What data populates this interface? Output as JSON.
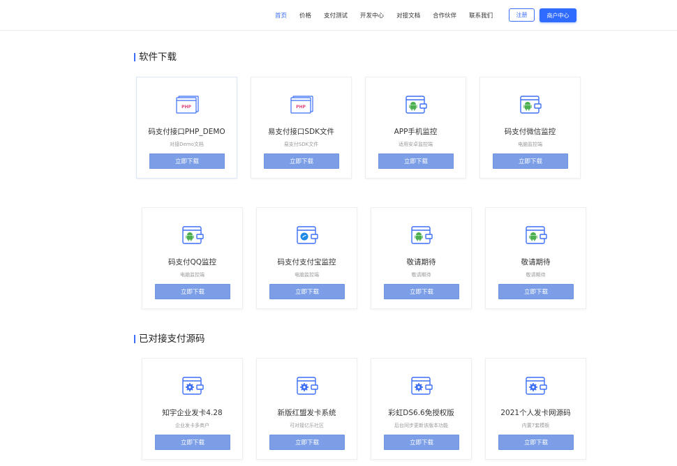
{
  "nav": {
    "items": [
      {
        "label": "首页",
        "active": true
      },
      {
        "label": "价格",
        "active": false
      },
      {
        "label": "支付测试",
        "active": false
      },
      {
        "label": "开发中心",
        "active": false
      },
      {
        "label": "对接文档",
        "active": false
      },
      {
        "label": "合作伙伴",
        "active": false
      },
      {
        "label": "联系我们",
        "active": false
      }
    ],
    "register_label": "注册",
    "client_label": "商户中心"
  },
  "sections": [
    {
      "title": "软件下载"
    },
    {
      "title": "已对接支付源码"
    }
  ],
  "download_cards": [
    {
      "icon": "php-demo-icon",
      "title": "码支付接口PHP_DEMO",
      "sub": "对接Demo文档",
      "button": "立即下载"
    },
    {
      "icon": "php-sdk-icon",
      "title": "易支付接口SDK文件",
      "sub": "易支付SDK文件",
      "button": "立即下载"
    },
    {
      "icon": "android-wallet-icon",
      "title": "APP手机监控",
      "sub": "适用安卓监控端",
      "button": "立即下载"
    },
    {
      "icon": "android-wallet-icon",
      "title": "码支付微信监控",
      "sub": "电脑监控端",
      "button": "立即下载"
    },
    {
      "icon": "android-wallet-icon",
      "title": "码支付QQ监控",
      "sub": "电脑监控端",
      "button": "立即下载"
    },
    {
      "icon": "alipay-wallet-icon",
      "title": "码支付支付宝监控",
      "sub": "电脑监控端",
      "button": "立即下载"
    },
    {
      "icon": "android-wallet-icon",
      "title": "敬请期待",
      "sub": "敬请期待",
      "button": "立即下载"
    },
    {
      "icon": "android-wallet-icon",
      "title": "敬请期待",
      "sub": "敬请期待",
      "button": "立即下载"
    }
  ],
  "source_cards": [
    {
      "icon": "gear-wallet-icon",
      "title": "知宇企业发卡4.28",
      "sub": "企业发卡多商户",
      "button": "立即下载"
    },
    {
      "icon": "gear-wallet-icon",
      "title": "新版红盟发卡系统",
      "sub": "可对接亿乐社区",
      "button": "立即下载"
    },
    {
      "icon": "gear-wallet-icon",
      "title": "彩虹DS6.6免授权版",
      "sub": "后台同步更新该版本功能",
      "button": "立即下载"
    },
    {
      "icon": "gear-wallet-icon",
      "title": "2021个人发卡网源码",
      "sub": "内置7套模板",
      "button": "立即下载"
    }
  ],
  "colors": {
    "accent": "#3b6ef5",
    "button": "#7b9ee6",
    "android": "#4caf50",
    "alipay": "#1e88e5"
  }
}
